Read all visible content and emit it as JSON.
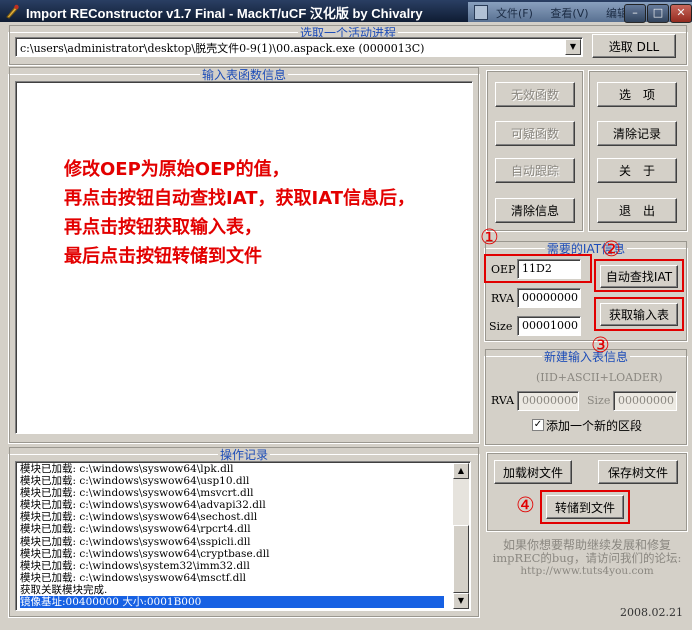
{
  "window": {
    "title": "Import REConstructor v1.7 Final - MackT/uCF 汉化版 by Chivalry",
    "background_window_menu": [
      "文件(F)",
      "查看(V)",
      "编辑"
    ]
  },
  "process": {
    "legend": "选取一个活动进程",
    "selected": "c:\\users\\administrator\\desktop\\脱壳文件0-9(1)\\00.aspack.exe (0000013C)",
    "pick_dll_label": "选取 DLL"
  },
  "imports": {
    "legend": "输入表函数信息"
  },
  "annotation": {
    "lines": [
      "修改OEP为原始OEP的值，",
      "再点击按钮自动查找IAT，获取IAT信息后，",
      "再点击按钮获取输入表，",
      "最后点击按钮转储到文件"
    ],
    "step_markers": [
      "①",
      "②",
      "③",
      "④"
    ],
    "color": "#e10000"
  },
  "right_buttons": {
    "invalid_funcs": "无效函数",
    "options": "选　项",
    "suspect_funcs": "可疑函数",
    "clear_log": "清除记录",
    "auto_trace": "自动跟踪",
    "about": "关　于",
    "clear_info": "清除信息",
    "exit": "退　出"
  },
  "iat": {
    "legend": "需要的IAT信息",
    "oep_label": "OEP",
    "oep_value": "11D2",
    "rva_label": "RVA",
    "rva_value": "00000000",
    "size_label": "Size",
    "size_value": "00001000",
    "auto_search_label": "自动查找IAT",
    "get_imports_label": "获取输入表"
  },
  "new_import": {
    "legend": "新建输入表信息",
    "subtitle": "(IID+ASCII+LOADER)",
    "rva_label": "RVA",
    "rva_value": "00000000",
    "size_label": "Size",
    "size_value": "00000000",
    "add_section_label": "添加一个新的区段",
    "add_section_checked": true
  },
  "log": {
    "legend": "操作记录",
    "lines": [
      "模块已加载: c:\\windows\\syswow64\\lpk.dll",
      "模块已加载: c:\\windows\\syswow64\\usp10.dll",
      "模块已加载: c:\\windows\\syswow64\\msvcrt.dll",
      "模块已加载: c:\\windows\\syswow64\\advapi32.dll",
      "模块已加载: c:\\windows\\syswow64\\sechost.dll",
      "模块已加载: c:\\windows\\syswow64\\rpcrt4.dll",
      "模块已加载: c:\\windows\\syswow64\\sspicli.dll",
      "模块已加载: c:\\windows\\syswow64\\cryptbase.dll",
      "模块已加载: c:\\windows\\system32\\imm32.dll",
      "模块已加载: c:\\windows\\syswow64\\msctf.dll",
      "获取关联模块完成."
    ],
    "selected_line": "镜像基址:00400000 大小:0001B000"
  },
  "tree_buttons": {
    "load_tree": "加载树文件",
    "save_tree": "保存树文件",
    "dump_to_file": "转储到文件"
  },
  "footer": {
    "help_line1": "如果你想要帮助继续发展和修复",
    "help_line2": "impREC的bug，请访问我们的论坛:",
    "url": "http://www.tuts4you.com",
    "date": "2008.02.21"
  }
}
